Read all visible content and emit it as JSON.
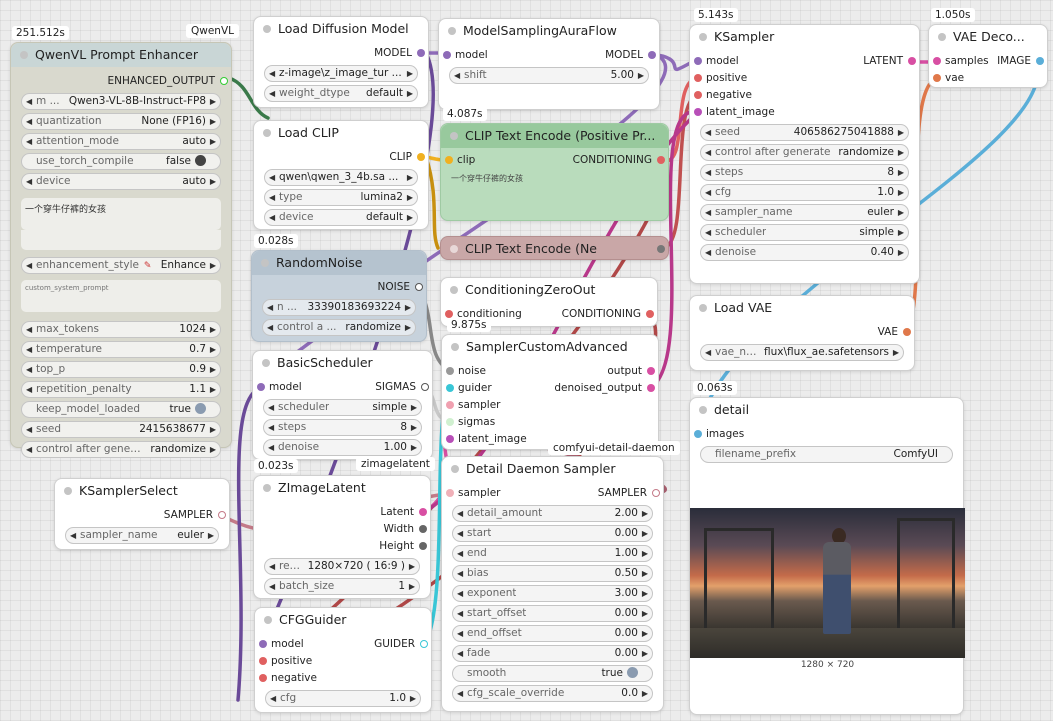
{
  "colors": {
    "model": "#8e6bb8",
    "clip": "#f0b020",
    "conditioning": "#e06060",
    "latent": "#d84fa3",
    "vae": "#e0784a",
    "image": "#5aaed8",
    "noise": "#999999",
    "sampler": "#c47a88",
    "sigmas": "#c8c8c8",
    "guider": "#39c6d6",
    "string": "#7ec86e",
    "bg": "#ececec"
  },
  "qwen": {
    "timing": "251.512s",
    "badge": "QwenVL",
    "title": "QwenVL Prompt Enhancer",
    "output": "ENHANCED_OUTPUT",
    "w": [
      {
        "n": "m ...",
        "v": "Qwen3-VL-8B-Instruct-FP8"
      },
      {
        "n": "quantization",
        "v": "None (FP16)"
      },
      {
        "n": "attention_mode",
        "v": "auto"
      },
      {
        "n": "use_torch_compile",
        "v": "false"
      },
      {
        "n": "device",
        "v": "auto"
      }
    ],
    "prompt_text": "一个穿牛仔裤的女孩",
    "style": {
      "n": "enhancement_style",
      "v": "Enhance"
    },
    "system_prompt_label": "custom_system_prompt",
    "w2": [
      {
        "n": "max_tokens",
        "v": "1024"
      },
      {
        "n": "temperature",
        "v": "0.7"
      },
      {
        "n": "top_p",
        "v": "0.9"
      },
      {
        "n": "repetition_penalty",
        "v": "1.1"
      },
      {
        "n": "keep_model_loaded",
        "v": "true"
      },
      {
        "n": "seed",
        "v": "2415638677"
      },
      {
        "n": "control after gener ...",
        "v": "randomize"
      }
    ]
  },
  "load_diffusion": {
    "title": "Load Diffusion Model",
    "output": "MODEL",
    "w": [
      {
        "n": "",
        "v": "z-image\\z_image_tur ..."
      },
      {
        "n": "weight_dtype",
        "v": "default"
      }
    ]
  },
  "load_clip": {
    "title": "Load CLIP",
    "output": "CLIP",
    "w": [
      {
        "n": "",
        "v": "qwen\\qwen_3_4b.sa ..."
      },
      {
        "n": "type",
        "v": "lumina2"
      },
      {
        "n": "device",
        "v": "default"
      }
    ]
  },
  "random_noise": {
    "timing": "0.028s",
    "title": "RandomNoise",
    "output": "NOISE",
    "w": [
      {
        "n": "n ...",
        "v": "33390183693224"
      },
      {
        "n": "control a ...",
        "v": "randomize"
      }
    ]
  },
  "basic_scheduler": {
    "title": "BasicScheduler",
    "input": "model",
    "output": "SIGMAS",
    "w": [
      {
        "n": "scheduler",
        "v": "simple"
      },
      {
        "n": "steps",
        "v": "8"
      },
      {
        "n": "denoise",
        "v": "1.00"
      }
    ]
  },
  "ksampler_select": {
    "title": "KSamplerSelect",
    "output": "SAMPLER",
    "w": [
      {
        "n": "sampler_name",
        "v": "euler"
      }
    ]
  },
  "zimage_latent": {
    "timing": "0.023s",
    "badge": "zimagelatent",
    "title": "ZImageLatent",
    "outputs": [
      "Latent",
      "Width",
      "Height"
    ],
    "w": [
      {
        "n": "re ...",
        "v": "1280×720 ( 16:9 )"
      },
      {
        "n": "batch_size",
        "v": "1"
      }
    ]
  },
  "cfg_guider": {
    "title": "CFGGuider",
    "inputs": [
      "model",
      "positive",
      "negative"
    ],
    "output": "GUIDER",
    "w": [
      {
        "n": "cfg",
        "v": "1.0"
      }
    ]
  },
  "model_sampling": {
    "title": "ModelSamplingAuraFlow",
    "input": "model",
    "output": "MODEL",
    "w": [
      {
        "n": "shift",
        "v": "5.00"
      }
    ]
  },
  "clip_pos": {
    "timing": "4.087s",
    "title": "CLIP Text Encode (Positive Pr...",
    "input": "clip",
    "output": "CONDITIONING",
    "text": "一个穿牛仔裤的女孩"
  },
  "clip_neg": {
    "title": "CLIP Text Encode (Ne"
  },
  "cond_zero": {
    "title": "ConditioningZeroOut",
    "input": "conditioning",
    "output": "CONDITIONING"
  },
  "sampler_custom": {
    "timing": "9.875s",
    "title": "SamplerCustomAdvanced",
    "inputs": [
      "noise",
      "guider",
      "sampler",
      "sigmas",
      "latent_image"
    ],
    "outputs": [
      "output",
      "denoised_output"
    ]
  },
  "detail_daemon": {
    "badge": "comfyui-detail-daemon",
    "title": "Detail Daemon Sampler",
    "input": "sampler",
    "output": "SAMPLER",
    "w": [
      {
        "n": "detail_amount",
        "v": "2.00"
      },
      {
        "n": "start",
        "v": "0.00"
      },
      {
        "n": "end",
        "v": "1.00"
      },
      {
        "n": "bias",
        "v": "0.50"
      },
      {
        "n": "exponent",
        "v": "3.00"
      },
      {
        "n": "start_offset",
        "v": "0.00"
      },
      {
        "n": "end_offset",
        "v": "0.00"
      },
      {
        "n": "fade",
        "v": "0.00"
      }
    ],
    "smooth": {
      "n": "smooth",
      "v": "true"
    },
    "cfg_override": {
      "n": "cfg_scale_override",
      "v": "0.0"
    }
  },
  "ksampler": {
    "timing": "5.143s",
    "title": "KSampler",
    "inputs": [
      "model",
      "positive",
      "negative",
      "latent_image"
    ],
    "output": "LATENT",
    "w": [
      {
        "n": "seed",
        "v": "406586275041888"
      },
      {
        "n": "control after generate",
        "v": "randomize"
      },
      {
        "n": "steps",
        "v": "8"
      },
      {
        "n": "cfg",
        "v": "1.0"
      },
      {
        "n": "sampler_name",
        "v": "euler"
      },
      {
        "n": "scheduler",
        "v": "simple"
      },
      {
        "n": "denoise",
        "v": "0.40"
      }
    ]
  },
  "vae_decode": {
    "timing": "1.050s",
    "title": "VAE Deco...",
    "inputs": [
      "samples",
      "vae"
    ],
    "output": "IMAGE"
  },
  "load_vae": {
    "title": "Load VAE",
    "output": "VAE",
    "w": [
      {
        "n": "vae_n ...",
        "v": "flux\\flux_ae.safetensors"
      }
    ]
  },
  "detail": {
    "timing": "0.063s",
    "title": "detail",
    "input": "images",
    "w": [
      {
        "n": "filename_prefix",
        "v": "ComfyUI"
      }
    ],
    "image_caption": "1280 × 720"
  }
}
